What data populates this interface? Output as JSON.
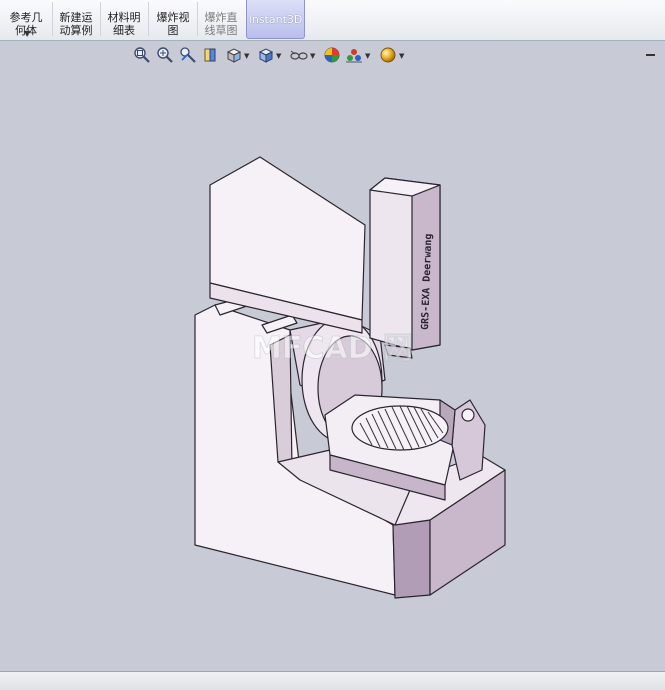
{
  "ribbon": {
    "buttons": [
      {
        "id": "ref-geometry",
        "label": "参考几\n何体",
        "state": "normal"
      },
      {
        "id": "new-motion-study",
        "label": "新建运\n动算例",
        "state": "normal"
      },
      {
        "id": "bom",
        "label": "材料明\n细表",
        "state": "normal"
      },
      {
        "id": "exploded-view",
        "label": "爆炸视\n图",
        "state": "normal"
      },
      {
        "id": "explode-line-sketch",
        "label": "爆炸直\n线草图",
        "state": "disabled"
      },
      {
        "id": "instant3d",
        "label": "Instant3D",
        "state": "active"
      }
    ]
  },
  "view_toolbar": {
    "icons": [
      "zoom-to-fit-icon",
      "zoom-area-icon",
      "previous-view-icon",
      "section-view-icon",
      "view-orientation-icon",
      "display-style-icon",
      "hide-show-items-icon",
      "edit-appearance-icon",
      "apply-scene-icon",
      "view-settings-icon"
    ]
  },
  "watermark": {
    "text": "MFCAD 网"
  },
  "model_engraving": {
    "text": "GRS-EXA Deerwang"
  },
  "colors": {
    "viewport_bg": "#c8cbd6",
    "model_face_light": "#f6f1f6",
    "model_face_mid": "#d9cdda",
    "model_face_dark": "#b19db6",
    "active_button": "#b9bfec"
  }
}
